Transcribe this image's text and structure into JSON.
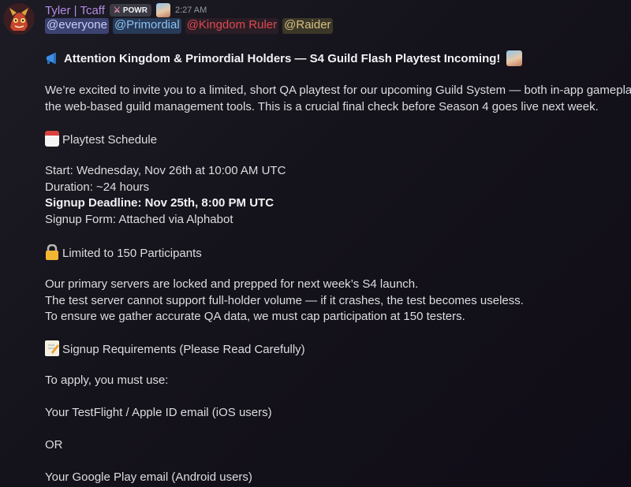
{
  "author": {
    "name": "Tyler | Tcaff",
    "tag": "POWR",
    "time": "2:27 AM"
  },
  "mentions": [
    "@everyone",
    "@Primordial",
    "@Kingdom Ruler",
    "@Raider"
  ],
  "colors": {
    "username": "#b28ce4",
    "kingdom_ruler": "#e0474f",
    "primordial": "#8ec1f0",
    "raider": "#d8bf84"
  },
  "body": {
    "headline": "Attention Kingdom & Primordial Holders — S4 Guild Flash Playtest Incoming!",
    "intro_1": "We’re excited to invite you to a limited, short QA playtest for our upcoming Guild System — both in-app gameplay and",
    "intro_2": "the web-based guild management tools. This is a crucial final check before Season 4 goes live next week.",
    "schedule_heading": "Playtest Schedule",
    "start": "Start: Wednesday, Nov 26th at 10:00 AM UTC",
    "duration": "Duration: ~24 hours",
    "deadline": "Signup Deadline: Nov 25th, 8:00 PM UTC",
    "form": "Signup Form: Attached via Alphabot",
    "limit_heading": "Limited to 150 Participants",
    "servers_1": "Our primary servers are locked and prepped for next week’s S4 launch.",
    "servers_2": "The test server cannot support full-holder volume — if it crashes, the test becomes useless.",
    "servers_3": "To ensure we gather accurate QA data, we must cap participation at 150 testers.",
    "requirements_heading": "Signup Requirements (Please Read Carefully)",
    "apply": "To apply, you must use:",
    "ios": "Your TestFlight / Apple ID email (iOS users)",
    "or": "OR",
    "android": "Your Google Play email (Android users)"
  },
  "icons": [
    "megaphone-icon",
    "calendar-icon",
    "lock-icon",
    "memo-icon"
  ]
}
